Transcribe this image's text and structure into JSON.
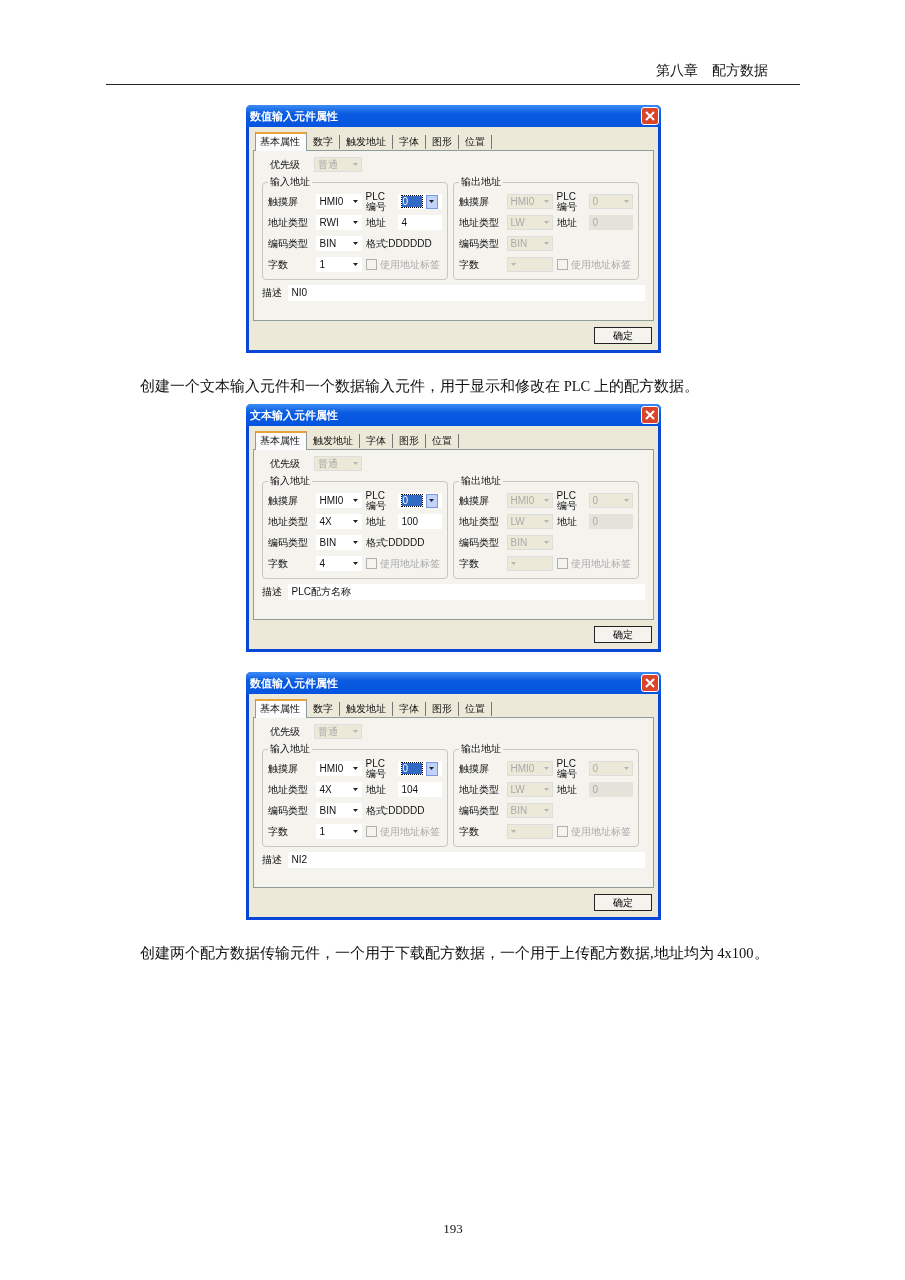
{
  "header": {
    "chapter": "第八章",
    "title": "配方数据"
  },
  "content": [
    {
      "kind": "dialog",
      "title": "数值输入元件属性",
      "tabs": [
        {
          "label": "基本属性",
          "selected": true
        },
        {
          "label": "数字",
          "selected": false
        },
        {
          "label": "触发地址",
          "selected": false
        },
        {
          "label": "字体",
          "selected": false
        },
        {
          "label": "图形",
          "selected": false
        },
        {
          "label": "位置",
          "selected": false
        }
      ],
      "priority": {
        "label": "优先级",
        "value": "普通",
        "disabled": true
      },
      "groups": [
        {
          "title": "输入地址",
          "disabled": false,
          "screen": {
            "label": "触摸屏",
            "value": "HMI0"
          },
          "plc": {
            "label_top": "PLC",
            "label_bottom": "编号",
            "value": "0",
            "highlighted": true
          },
          "address_type": {
            "label": "地址类型",
            "value": "RWI"
          },
          "address": {
            "label": "地址",
            "value": "4"
          },
          "encoding": {
            "label": "编码类型",
            "value": "BIN"
          },
          "format": "格式:DDDDDD",
          "word_count": {
            "label": "字数",
            "value": "1"
          },
          "use_tag": {
            "label": "使用地址标签",
            "checked": false,
            "disabled": true
          }
        },
        {
          "title": "输出地址",
          "disabled": true,
          "screen": {
            "label": "触摸屏",
            "value": "HMI0"
          },
          "plc": {
            "label_top": "PLC",
            "label_bottom": "编号",
            "value": "0",
            "highlighted": false
          },
          "address_type": {
            "label": "地址类型",
            "value": "LW"
          },
          "address": {
            "label": "地址",
            "value": "0"
          },
          "encoding": {
            "label": "编码类型",
            "value": "BIN"
          },
          "word_count": {
            "label": "字数"
          },
          "use_tag": {
            "label": "使用地址标签",
            "checked": false,
            "disabled": true
          }
        }
      ],
      "description": {
        "label": "描述",
        "value": "NI0"
      },
      "ok_button": "确定"
    },
    {
      "kind": "paragraph",
      "text": "创建一个文本输入元件和一个数据输入元件，用于显示和修改在 PLC 上的配方数据。"
    },
    {
      "kind": "dialog",
      "title": "文本输入元件属性",
      "tabs": [
        {
          "label": "基本属性",
          "selected": true
        },
        {
          "label": "触发地址",
          "selected": false
        },
        {
          "label": "字体",
          "selected": false
        },
        {
          "label": "图形",
          "selected": false
        },
        {
          "label": "位置",
          "selected": false
        }
      ],
      "priority": {
        "label": "优先级",
        "value": "普通",
        "disabled": true
      },
      "groups": [
        {
          "title": "输入地址",
          "disabled": false,
          "screen": {
            "label": "触摸屏",
            "value": "HMI0"
          },
          "plc": {
            "label_top": "PLC",
            "label_bottom": "编号",
            "value": "0",
            "highlighted": true
          },
          "address_type": {
            "label": "地址类型",
            "value": "4X"
          },
          "address": {
            "label": "地址",
            "value": "100"
          },
          "encoding": {
            "label": "编码类型",
            "value": "BIN"
          },
          "format": "格式:DDDDD",
          "word_count": {
            "label": "字数",
            "value": "4"
          },
          "use_tag": {
            "label": "使用地址标签",
            "checked": false,
            "disabled": true
          }
        },
        {
          "title": "输出地址",
          "disabled": true,
          "screen": {
            "label": "触摸屏",
            "value": "HMI0"
          },
          "plc": {
            "label_top": "PLC",
            "label_bottom": "编号",
            "value": "0",
            "highlighted": false
          },
          "address_type": {
            "label": "地址类型",
            "value": "LW"
          },
          "address": {
            "label": "地址",
            "value": "0"
          },
          "encoding": {
            "label": "编码类型",
            "value": "BIN"
          },
          "word_count": {
            "label": "字数"
          },
          "use_tag": {
            "label": "使用地址标签",
            "checked": false,
            "disabled": true
          }
        }
      ],
      "description": {
        "label": "描述",
        "value": "PLC配方名称"
      },
      "ok_button": "确定"
    },
    {
      "kind": "dialog",
      "title": "数值输入元件属性",
      "tabs": [
        {
          "label": "基本属性",
          "selected": true
        },
        {
          "label": "数字",
          "selected": false
        },
        {
          "label": "触发地址",
          "selected": false
        },
        {
          "label": "字体",
          "selected": false
        },
        {
          "label": "图形",
          "selected": false
        },
        {
          "label": "位置",
          "selected": false
        }
      ],
      "priority": {
        "label": "优先级",
        "value": "普通",
        "disabled": true
      },
      "groups": [
        {
          "title": "输入地址",
          "disabled": false,
          "screen": {
            "label": "触摸屏",
            "value": "HMI0"
          },
          "plc": {
            "label_top": "PLC",
            "label_bottom": "编号",
            "value": "0",
            "highlighted": true
          },
          "address_type": {
            "label": "地址类型",
            "value": "4X"
          },
          "address": {
            "label": "地址",
            "value": "104"
          },
          "encoding": {
            "label": "编码类型",
            "value": "BIN"
          },
          "format": "格式:DDDDD",
          "word_count": {
            "label": "字数",
            "value": "1"
          },
          "use_tag": {
            "label": "使用地址标签",
            "checked": false,
            "disabled": true
          }
        },
        {
          "title": "输出地址",
          "disabled": true,
          "screen": {
            "label": "触摸屏",
            "value": "HMI0"
          },
          "plc": {
            "label_top": "PLC",
            "label_bottom": "编号",
            "value": "0",
            "highlighted": false
          },
          "address_type": {
            "label": "地址类型",
            "value": "LW"
          },
          "address": {
            "label": "地址",
            "value": "0"
          },
          "encoding": {
            "label": "编码类型",
            "value": "BIN"
          },
          "word_count": {
            "label": "字数"
          },
          "use_tag": {
            "label": "使用地址标签",
            "checked": false,
            "disabled": true
          }
        }
      ],
      "description": {
        "label": "描述",
        "value": "NI2"
      },
      "ok_button": "确定"
    },
    {
      "kind": "paragraph",
      "text": "创建两个配方数据传输元件，一个用于下载配方数据，一个用于上传配方数据,地址均为 4x100。"
    }
  ],
  "page_number": "193"
}
